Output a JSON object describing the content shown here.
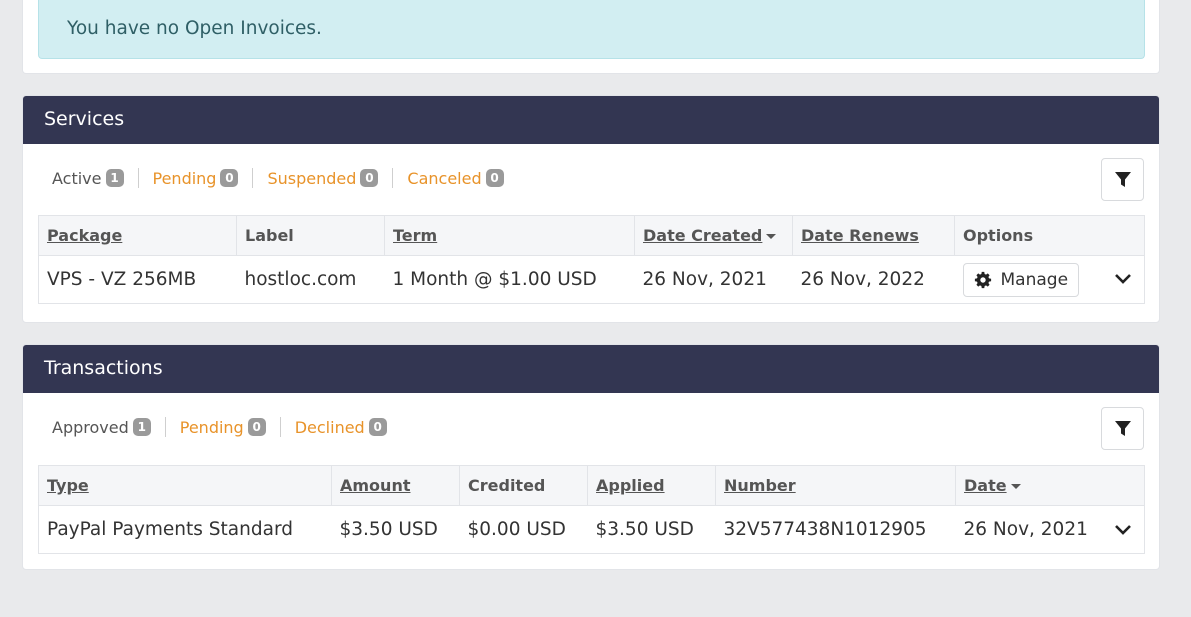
{
  "alert": {
    "text": "You have no Open Invoices."
  },
  "services": {
    "title": "Services",
    "filters": [
      {
        "label": "Active",
        "count": "1",
        "color": "#555555"
      },
      {
        "label": "Pending",
        "count": "0",
        "color": "#e8932a"
      },
      {
        "label": "Suspended",
        "count": "0",
        "color": "#e8932a"
      },
      {
        "label": "Canceled",
        "count": "0",
        "color": "#e8932a"
      }
    ],
    "columns": [
      "Package",
      "Label",
      "Term",
      "Date Created",
      "Date Renews",
      "Options"
    ],
    "rows": [
      {
        "package": "VPS - VZ 256MB",
        "label": "hostloc.com",
        "term": "1 Month @ $1.00 USD",
        "date_created": "26 Nov, 2021",
        "date_renews": "26 Nov, 2022",
        "manage_label": "Manage"
      }
    ]
  },
  "transactions": {
    "title": "Transactions",
    "filters": [
      {
        "label": "Approved",
        "count": "1",
        "color": "#555555"
      },
      {
        "label": "Pending",
        "count": "0",
        "color": "#e8932a"
      },
      {
        "label": "Declined",
        "count": "0",
        "color": "#e8932a"
      }
    ],
    "columns": [
      "Type",
      "Amount",
      "Credited",
      "Applied",
      "Number",
      "Date"
    ],
    "rows": [
      {
        "type": "PayPal Payments Standard",
        "amount": "$3.50 USD",
        "credited": "$0.00 USD",
        "applied": "$3.50 USD",
        "number": "32V577438N1012905",
        "date": "26 Nov, 2021"
      }
    ]
  }
}
